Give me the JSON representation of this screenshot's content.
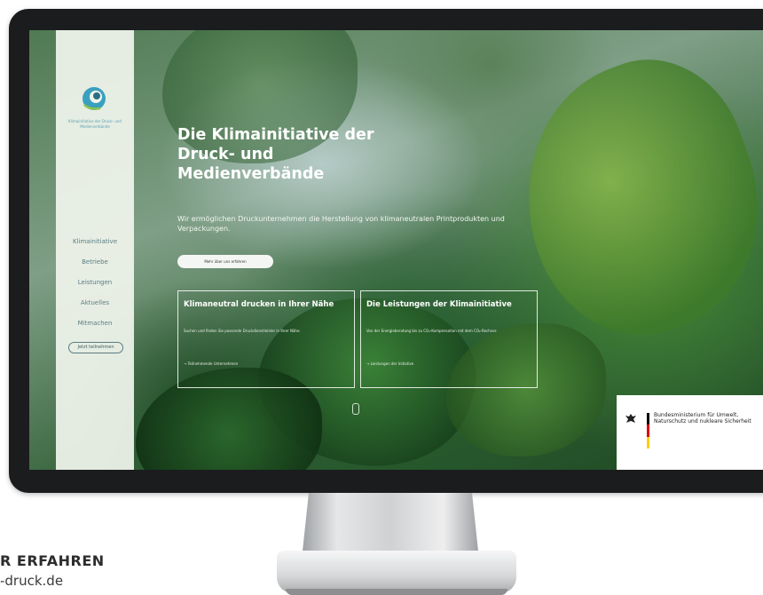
{
  "sidebar": {
    "logo_text": "Klimainitiative der Druck- und Medienverbände",
    "nav": [
      "Klimainitiative",
      "Betriebe",
      "Leistungen",
      "Aktuelles",
      "Mitmachen"
    ],
    "pill_label": "Jetzt teilnehmen"
  },
  "hero": {
    "title": "Die Klimainitiative der Druck- und Medienverbände",
    "subtitle": "Wir ermöglichen Druckunternehmen die Herstellung von klimaneutralen Printprodukten und Verpackungen.",
    "button_label": "Mehr über uns erfahren"
  },
  "cards": [
    {
      "title": "Klimaneutral drucken in Ihrer Nähe",
      "text": "Suchen und finden Sie passende Druckdienstleister in Ihrer Nähe.",
      "link": "Teilnehmende Unternehmen"
    },
    {
      "title": "Die Leistungen der Klimainitiative",
      "text": "Von der Energieberatung bis zu CO₂-Kompensation mit dem CO₂-Rechner.",
      "link": "Leistungen der Initiative"
    }
  ],
  "ministry": {
    "text": "Bundesministerium für Umwelt, Naturschutz und nukleare Sicherheit"
  },
  "cta": {
    "title": "R ERFAHREN",
    "url": "-druck.de"
  },
  "colors": {
    "sidebar_bg": "#f0f4ec",
    "nav_text": "#5a7d84",
    "logo_accent": "#3aa0bf"
  },
  "icons": {
    "logo": "globe-leaf-icon",
    "scroll": "scroll-indicator-icon",
    "eagle": "federal-eagle-icon",
    "arrow": "arrow-right-icon"
  }
}
